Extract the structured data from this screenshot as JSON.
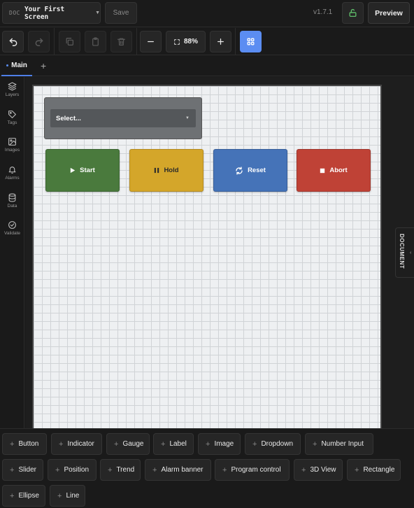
{
  "header": {
    "doc_tag": "DOC",
    "doc_title": "Your First Screen",
    "save_label": "Save",
    "version": "v1.7.1",
    "preview_label": "Preview"
  },
  "toolbar": {
    "zoom_label": "88%",
    "accent": "#5b8df2"
  },
  "tabs": {
    "main_label": "Main"
  },
  "sidebar": {
    "items": [
      {
        "label": "Layers",
        "icon": "layers-icon"
      },
      {
        "label": "Tags",
        "icon": "tag-icon"
      },
      {
        "label": "Images",
        "icon": "image-icon"
      },
      {
        "label": "Alarms",
        "icon": "bell-icon"
      },
      {
        "label": "Data",
        "icon": "database-icon"
      },
      {
        "label": "Validate",
        "icon": "check-circle-icon"
      }
    ]
  },
  "canvas": {
    "dropdown_placeholder": "Select...",
    "buttons": [
      {
        "label": "Start",
        "icon": "play-icon",
        "color": "#4a7a3d"
      },
      {
        "label": "Hold",
        "icon": "pause-icon",
        "color": "#d4a62a"
      },
      {
        "label": "Reset",
        "icon": "refresh-icon",
        "color": "#4573b8"
      },
      {
        "label": "Abort",
        "icon": "stop-icon",
        "color": "#bf4236"
      }
    ]
  },
  "document_panel": {
    "label": "DOCUMENT"
  },
  "palette": {
    "items": [
      "Button",
      "Indicator",
      "Gauge",
      "Label",
      "Image",
      "Dropdown",
      "Number Input",
      "Slider",
      "Position",
      "Trend",
      "Alarm banner",
      "Program control",
      "3D View",
      "Rectangle",
      "Ellipse",
      "Line"
    ]
  }
}
